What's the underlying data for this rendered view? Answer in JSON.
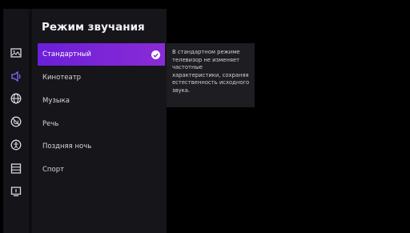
{
  "panel": {
    "title": "Режим звучания",
    "items": [
      {
        "label": "Стандартный",
        "selected": true
      },
      {
        "label": "Кинотеатр"
      },
      {
        "label": "Музыка"
      },
      {
        "label": "Речь"
      },
      {
        "label": "Поздняя ночь"
      },
      {
        "label": "Спорт"
      }
    ]
  },
  "rail": {
    "icons": [
      "picture-icon",
      "sound-icon",
      "globe-icon",
      "power-timer-icon",
      "accessibility-icon",
      "list-icon",
      "device-info-icon"
    ],
    "active": "sound-icon"
  },
  "tooltip": {
    "text": "В стандартном режиме телевизор не изменяет частотные характеристики, сохраняя естественность исходного звука."
  },
  "colors": {
    "accent_start": "#6b1fd8",
    "accent_end": "#8a2bd6",
    "active_icon": "#8a6bff"
  }
}
